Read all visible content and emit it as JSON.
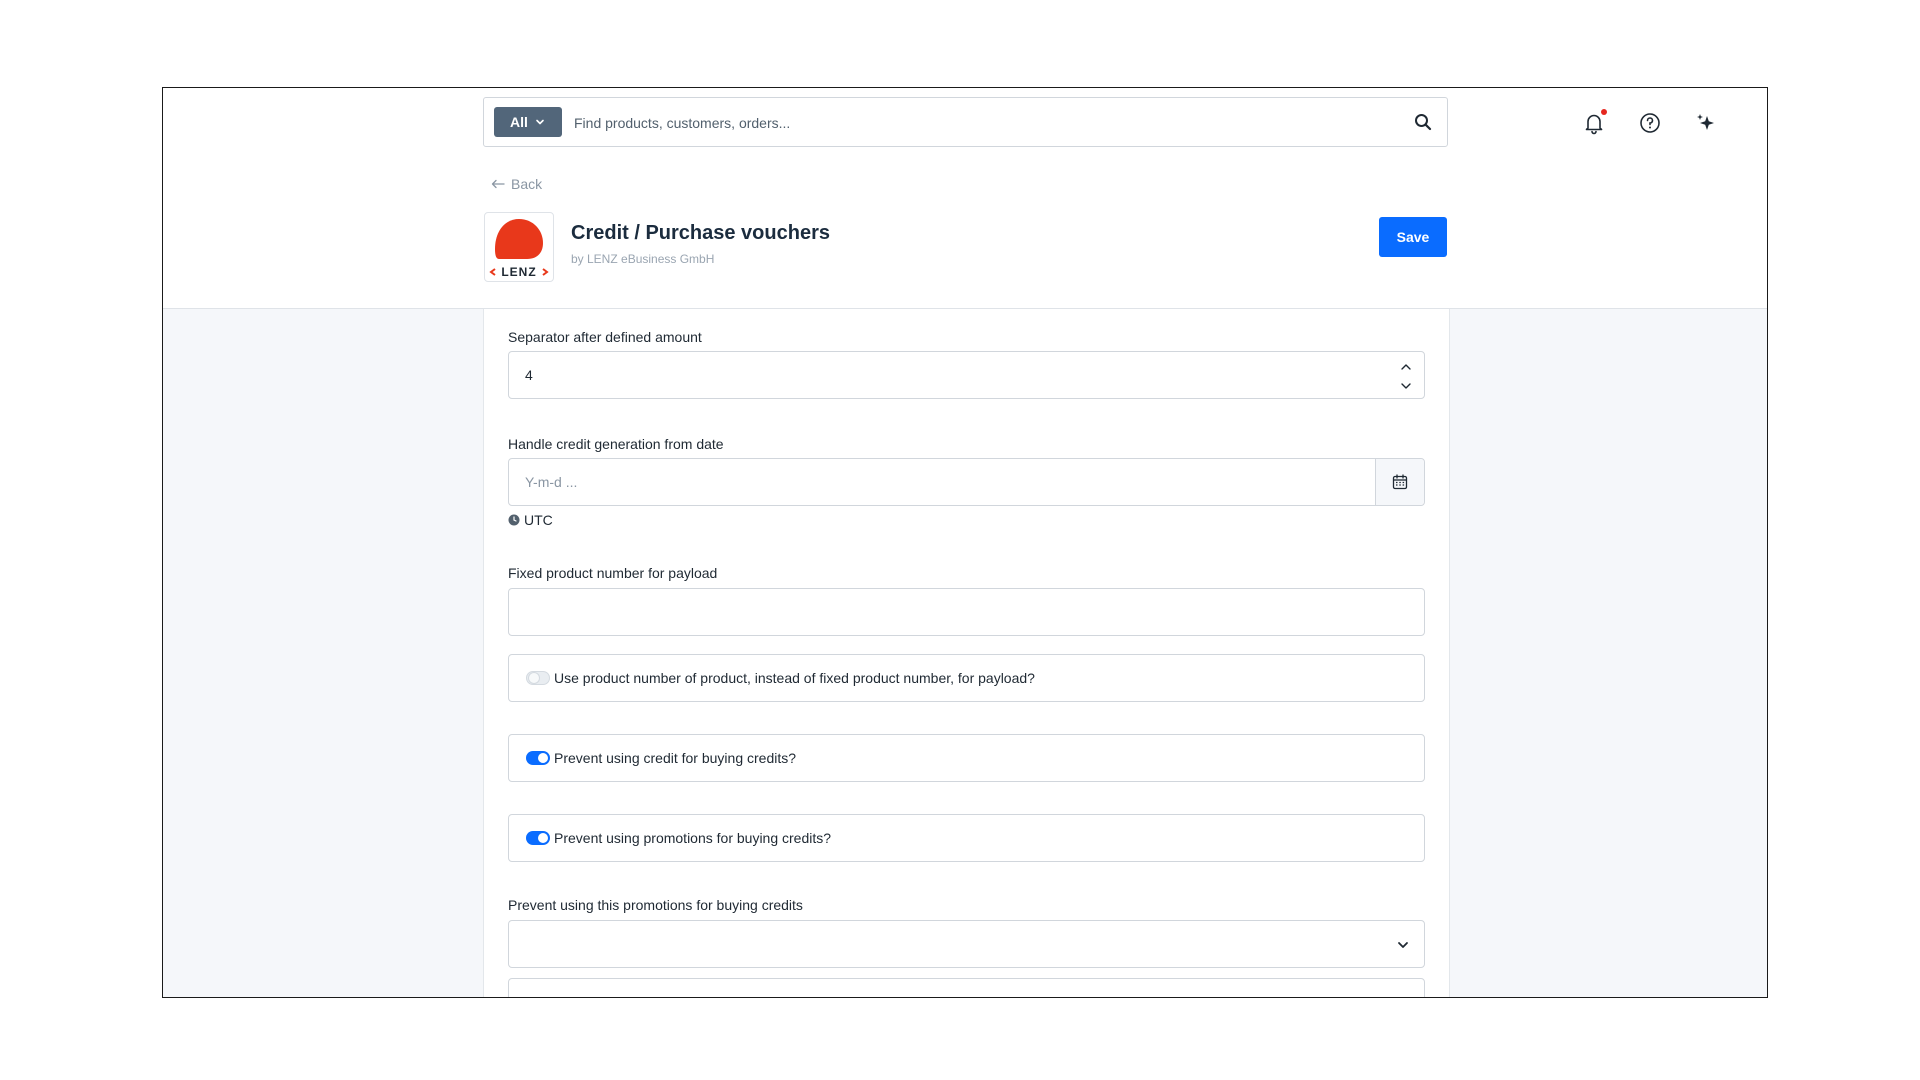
{
  "topbar": {
    "search": {
      "type_label": "All",
      "placeholder": "Find products, customers, orders..."
    },
    "icons": [
      "bell-icon",
      "help-circle-icon",
      "sparkle-icon"
    ]
  },
  "header": {
    "back_label": "Back",
    "logo_text": "LENZ",
    "title": "Credit / Purchase vouchers",
    "vendor": "by LENZ eBusiness GmbH",
    "save_label": "Save"
  },
  "form": {
    "separator": {
      "label": "Separator after defined amount",
      "value": "4"
    },
    "credit_date": {
      "label": "Handle credit generation from date",
      "placeholder": "Y-m-d ...",
      "timezone": "UTC"
    },
    "fixed_product_number": {
      "label": "Fixed product number for payload",
      "value": ""
    },
    "toggles": [
      {
        "label": "Use product number of product, instead of fixed product number, for payload?",
        "enabled": false
      },
      {
        "label": "Prevent using credit for buying credits?",
        "enabled": true
      },
      {
        "label": "Prevent using promotions for buying credits?",
        "enabled": true
      }
    ],
    "promotions_select": {
      "label": "Prevent using this promotions for buying credits",
      "value": ""
    }
  },
  "colors": {
    "primary": "#0a6cff",
    "search_type_bg": "#52667a",
    "logo_red": "#e8381b",
    "notification_dot": "#e5261f"
  }
}
